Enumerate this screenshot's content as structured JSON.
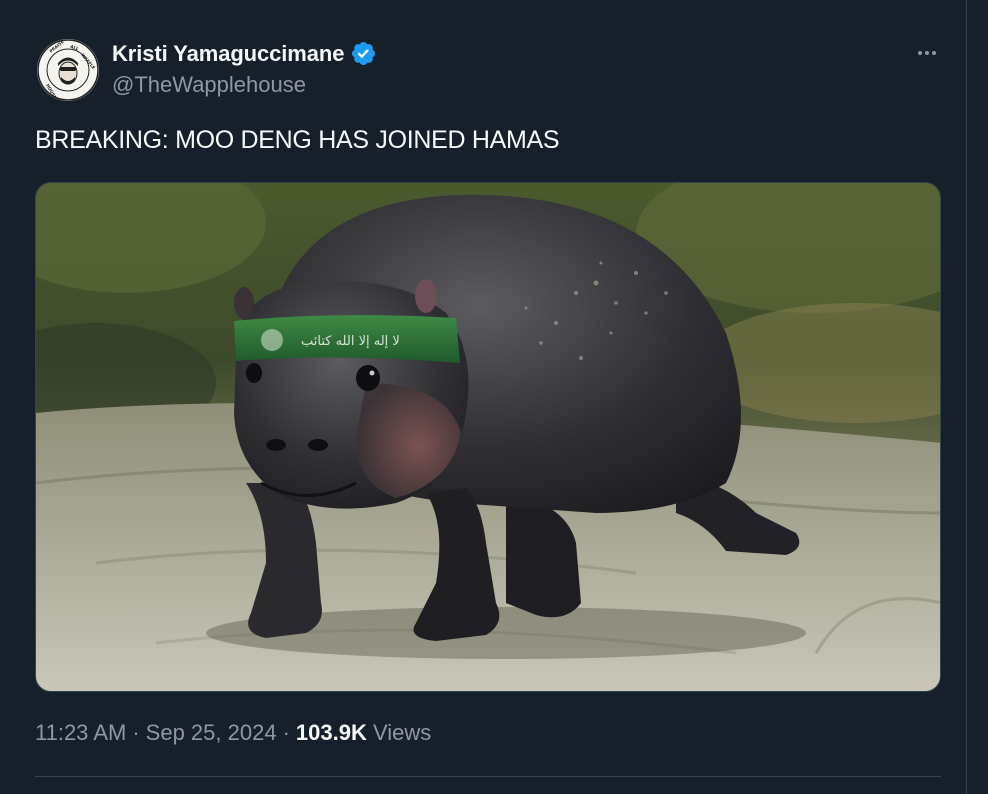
{
  "author": {
    "display_name": "Kristi Yamaguccimane",
    "handle": "@TheWapplehouse",
    "avatar_icon": "waffle-house-parody-logo",
    "avatar_text": "PRAISE ALL WAFFLE HOUSE"
  },
  "tweet": {
    "text": "BREAKING: MOO DENG HAS JOINED HAMAS",
    "image_headband_text": "لا إله إلا الله كتائب"
  },
  "meta": {
    "time": "11:23 AM",
    "sep1": "·",
    "date": "Sep 25, 2024",
    "sep2": "·",
    "views_count": "103.9K",
    "views_label": "Views"
  },
  "icons": {
    "verified": "verified-badge-icon",
    "more": "more-options-icon"
  },
  "colors": {
    "background": "#15202b",
    "text_primary": "#f7f9f9",
    "text_secondary": "#8b98a5",
    "verified_blue": "#1d9bf0",
    "border": "#38444d"
  }
}
